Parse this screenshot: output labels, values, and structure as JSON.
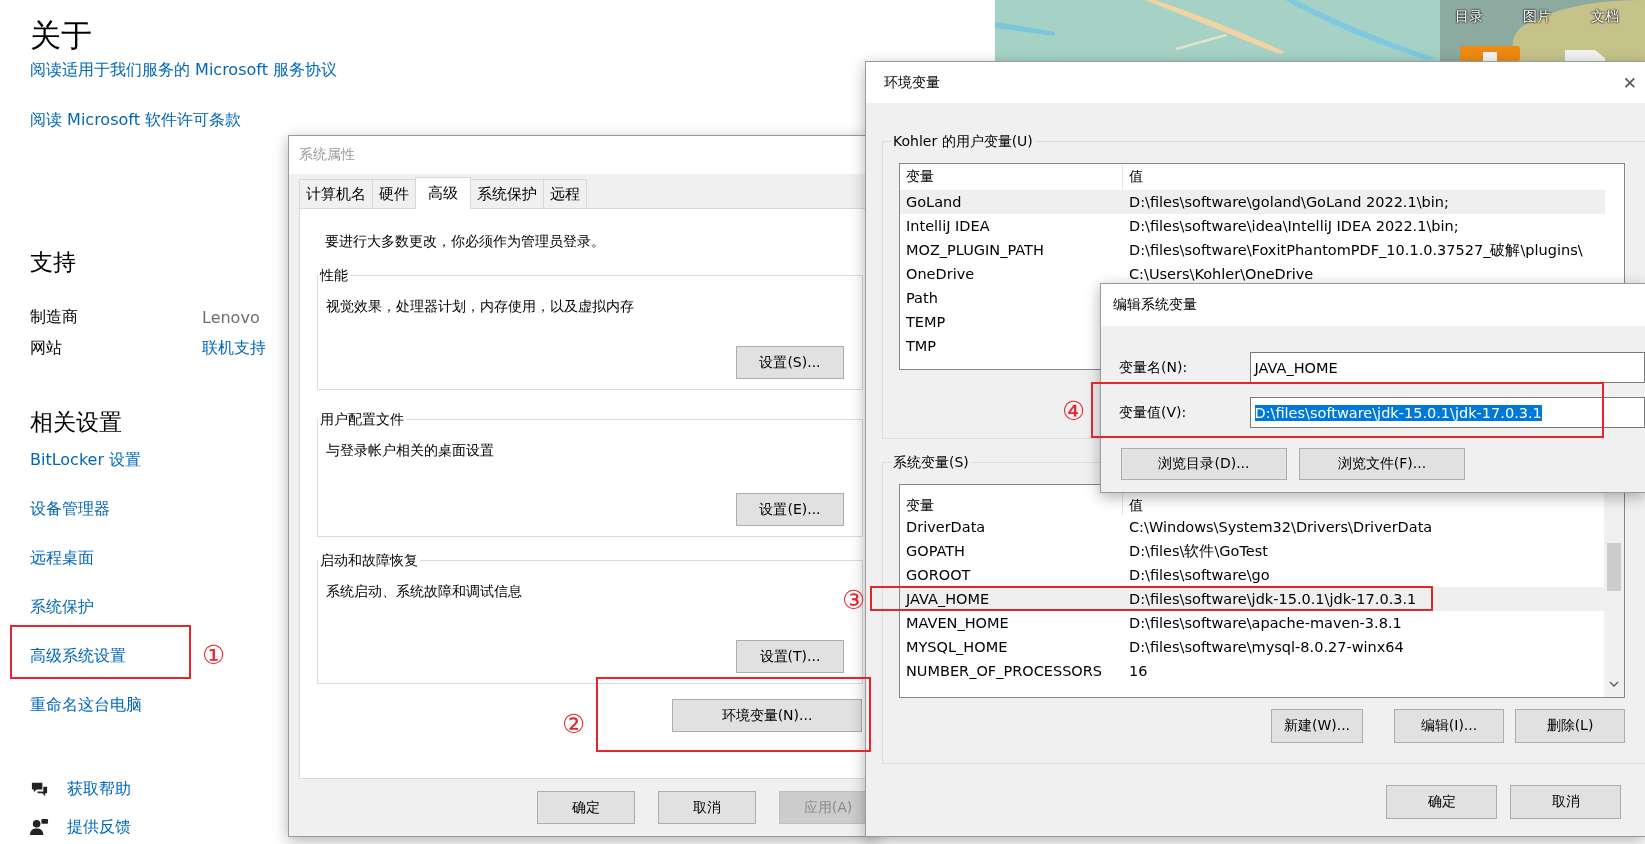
{
  "about": {
    "heading": "关于",
    "links": [
      "阅读适用于我们服务的 Microsoft 服务协议",
      "阅读 Microsoft 软件许可条款"
    ]
  },
  "support": {
    "heading": "支持",
    "rows": [
      {
        "label": "制造商",
        "value": "Lenovo",
        "kind": "text"
      },
      {
        "label": "网站",
        "value": "联机支持",
        "kind": "link"
      }
    ]
  },
  "related": {
    "heading": "相关设置",
    "links": [
      "BitLocker 设置",
      "设备管理器",
      "远程桌面",
      "系统保护",
      "高级系统设置",
      "重命名这台电脑"
    ]
  },
  "help_links": [
    {
      "label": "获取帮助",
      "kind": "help"
    },
    {
      "label": "提供反馈",
      "kind": "feedback"
    }
  ],
  "background_toolbar": [
    "目录",
    "图片",
    "文档"
  ],
  "system_properties": {
    "title": "系统属性",
    "tabs": [
      {
        "label": "计算机名",
        "selected": false
      },
      {
        "label": "硬件",
        "selected": false
      },
      {
        "label": "高级",
        "selected": true
      },
      {
        "label": "系统保护",
        "selected": false
      },
      {
        "label": "远程",
        "selected": false
      }
    ],
    "notice": "要进行大多数更改，你必须作为管理员登录。",
    "groups": [
      {
        "title": "性能",
        "text": "视觉效果，处理器计划，内存使用，以及虚拟内存",
        "button": "设置(S)..."
      },
      {
        "title": "用户配置文件",
        "text": "与登录帐户相关的桌面设置",
        "button": "设置(E)..."
      },
      {
        "title": "启动和故障恢复",
        "text": "系统启动、系统故障和调试信息",
        "button": "设置(T)..."
      }
    ],
    "env_button": "环境变量(N)...",
    "buttons": [
      {
        "label": "确定",
        "disabled": false
      },
      {
        "label": "取消",
        "disabled": false
      },
      {
        "label": "应用(A)",
        "disabled": true
      }
    ]
  },
  "env_dialog": {
    "title": "环境变量",
    "close": "✕",
    "user_group": {
      "title": "Kohler 的用户变量(U)",
      "columns": [
        "变量",
        "值"
      ],
      "rows": [
        {
          "name": "GoLand",
          "value": "D:\\files\\software\\goland\\GoLand 2022.1\\bin;",
          "selected": true
        },
        {
          "name": "IntelliJ IDEA",
          "value": "D:\\files\\software\\idea\\IntelliJ IDEA 2022.1\\bin;",
          "selected": false
        },
        {
          "name": "MOZ_PLUGIN_PATH",
          "value": "D:\\files\\software\\FoxitPhantomPDF_10.1.0.37527_破解\\plugins\\",
          "selected": false
        },
        {
          "name": "OneDrive",
          "value": "C:\\Users\\Kohler\\OneDrive",
          "selected": false
        },
        {
          "name": "Path",
          "selected": false
        },
        {
          "name": "TEMP",
          "selected": false
        },
        {
          "name": "TMP",
          "selected": false
        }
      ]
    },
    "system_group": {
      "title": "系统变量(S)",
      "columns": [
        "变量",
        "值"
      ],
      "rows": [
        {
          "name": "DriverData",
          "value": "C:\\Windows\\System32\\Drivers\\DriverData",
          "selected": false
        },
        {
          "name": "GOPATH",
          "value": "D:\\files\\软件\\GoTest",
          "selected": false
        },
        {
          "name": "GOROOT",
          "value": "D:\\files\\software\\go",
          "selected": false
        },
        {
          "name": "JAVA_HOME",
          "value": "D:\\files\\software\\jdk-15.0.1\\jdk-17.0.3.1",
          "selected": true
        },
        {
          "name": "MAVEN_HOME",
          "value": "D:\\files\\software\\apache-maven-3.8.1",
          "selected": false
        },
        {
          "name": "MYSQL_HOME",
          "value": "D:\\files\\software\\mysql-8.0.27-winx64",
          "selected": false
        },
        {
          "name": "NUMBER_OF_PROCESSORS",
          "value": "16",
          "selected": false
        }
      ],
      "buttons": [
        "新建(W)...",
        "编辑(I)...",
        "删除(L)"
      ]
    },
    "buttons": [
      "确定",
      "取消"
    ]
  },
  "edit_dialog": {
    "title": "编辑系统变量",
    "fields": [
      {
        "label": "变量名(N):",
        "value": "JAVA_HOME",
        "selected": false
      },
      {
        "label": "变量值(V):",
        "value": "D:\\files\\software\\jdk-15.0.1\\jdk-17.0.3.1",
        "selected": true
      }
    ],
    "buttons": [
      "浏览目录(D)...",
      "浏览文件(F)..."
    ]
  },
  "annotations": [
    {
      "number": "①"
    },
    {
      "number": "②"
    },
    {
      "number": "③"
    },
    {
      "number": "④"
    }
  ]
}
